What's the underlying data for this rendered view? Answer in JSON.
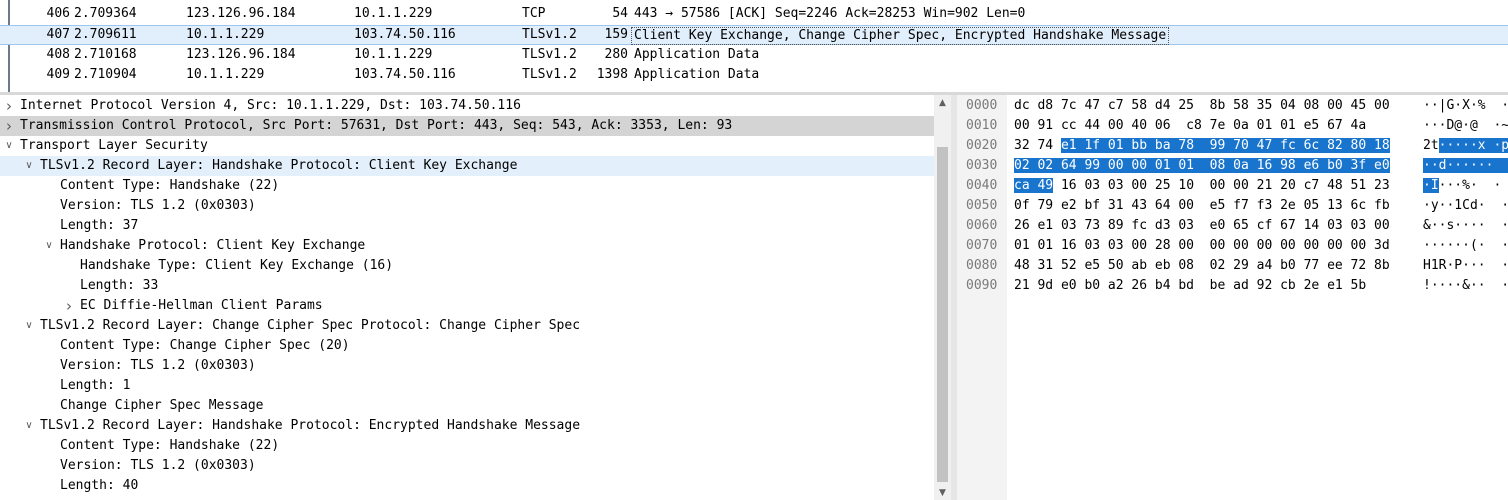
{
  "packet_list": {
    "rows": [
      {
        "no": "406",
        "time": "2.709364",
        "src": "123.126.96.184",
        "dst": "10.1.1.229",
        "proto": "TCP",
        "len": "54",
        "info": "443 → 57586 [ACK] Seq=2246 Ack=28253 Win=902 Len=0"
      },
      {
        "no": "407",
        "time": "2.709611",
        "src": "10.1.1.229",
        "dst": "103.74.50.116",
        "proto": "TLSv1.2",
        "len": "159",
        "info": "Client Key Exchange, Change Cipher Spec, Encrypted Handshake Message"
      },
      {
        "no": "408",
        "time": "2.710168",
        "src": "123.126.96.184",
        "dst": "10.1.1.229",
        "proto": "TLSv1.2",
        "len": "280",
        "info": "Application Data"
      },
      {
        "no": "409",
        "time": "2.710904",
        "src": "10.1.1.229",
        "dst": "103.74.50.116",
        "proto": "TLSv1.2",
        "len": "1398",
        "info": "Application Data"
      }
    ]
  },
  "details": {
    "rows": [
      {
        "indent": 0,
        "chevron": "right",
        "text": "Internet Protocol Version 4, Src: 10.1.1.229, Dst: 103.74.50.116"
      },
      {
        "indent": 0,
        "chevron": "right",
        "text": "Transmission Control Protocol, Src Port: 57631, Dst Port: 443, Seq: 543, Ack: 3353, Len: 93"
      },
      {
        "indent": 0,
        "chevron": "down",
        "text": "Transport Layer Security"
      },
      {
        "indent": 1,
        "chevron": "down",
        "text": "TLSv1.2 Record Layer: Handshake Protocol: Client Key Exchange"
      },
      {
        "indent": 2,
        "chevron": "",
        "text": "Content Type: Handshake (22)"
      },
      {
        "indent": 2,
        "chevron": "",
        "text": "Version: TLS 1.2 (0x0303)"
      },
      {
        "indent": 2,
        "chevron": "",
        "text": "Length: 37"
      },
      {
        "indent": 2,
        "chevron": "down",
        "text": "Handshake Protocol: Client Key Exchange"
      },
      {
        "indent": 3,
        "chevron": "",
        "text": "Handshake Type: Client Key Exchange (16)"
      },
      {
        "indent": 3,
        "chevron": "",
        "text": "Length: 33"
      },
      {
        "indent": 3,
        "chevron": "right",
        "text": "EC Diffie-Hellman Client Params"
      },
      {
        "indent": 1,
        "chevron": "down",
        "text": "TLSv1.2 Record Layer: Change Cipher Spec Protocol: Change Cipher Spec"
      },
      {
        "indent": 2,
        "chevron": "",
        "text": "Content Type: Change Cipher Spec (20)"
      },
      {
        "indent": 2,
        "chevron": "",
        "text": "Version: TLS 1.2 (0x0303)"
      },
      {
        "indent": 2,
        "chevron": "",
        "text": "Length: 1"
      },
      {
        "indent": 2,
        "chevron": "",
        "text": "Change Cipher Spec Message"
      },
      {
        "indent": 1,
        "chevron": "down",
        "text": "TLSv1.2 Record Layer: Handshake Protocol: Encrypted Handshake Message"
      },
      {
        "indent": 2,
        "chevron": "",
        "text": "Content Type: Handshake (22)"
      },
      {
        "indent": 2,
        "chevron": "",
        "text": "Version: TLS 1.2 (0x0303)"
      },
      {
        "indent": 2,
        "chevron": "",
        "text": "Length: 40"
      }
    ]
  },
  "bytes": {
    "rows": [
      {
        "offset": "0000",
        "hex": [
          "dc d8 7c 47 c7 58 d4 25  8b 58 35 04 08 00 45 00"
        ],
        "hexsel": "",
        "hexafter": "",
        "ascii": "··|G·X·%  ·X",
        "asciisel": "",
        "asciiafter": ""
      },
      {
        "offset": "0010",
        "hex": [
          "00 91 cc 44 00 40 06  c8 7e 0a 01 01 e5 67 4a"
        ],
        "hexsel": "",
        "hexafter": "",
        "ascii": "···D@·@  ·~",
        "asciisel": "",
        "asciiafter": ""
      },
      {
        "offset": "0020",
        "hex": [
          "32 74 "
        ],
        "hexsel": "e1 1f 01 bb ba 78  99 70 47 fc 6c 82 80 18",
        "hexafter": "",
        "ascii": "2t",
        "asciisel": "·····x ·p",
        "asciiafter": ""
      },
      {
        "offset": "0030",
        "hex": [
          ""
        ],
        "hexsel": "02 02 64 99 00 00 01 01  08 0a 16 98 e6 b0 3f e0",
        "hexafter": "",
        "ascii": "",
        "asciisel": "··d······  ·",
        "asciiafter": ""
      },
      {
        "offset": "0040",
        "hex": [
          ""
        ],
        "hexsel": "ca 49",
        "hexafter": " 16 03 03 00 25 10  00 00 21 20 c7 48 51 23",
        "ascii": "",
        "asciisel": "·I",
        "asciiafter": "···%·  ·"
      },
      {
        "offset": "0050",
        "hex": [
          "0f 79 e2 bf 31 43 64 00  e5 f7 f3 2e 05 13 6c fb"
        ],
        "hexsel": "",
        "hexafter": "",
        "ascii": "·y··1Cd·  ·",
        "asciisel": "",
        "asciiafter": ""
      },
      {
        "offset": "0060",
        "hex": [
          "26 e1 03 73 89 fc d3 03  e0 65 cf 67 14 03 03 00"
        ],
        "hexsel": "",
        "hexafter": "",
        "ascii": "&··s····  ·e",
        "asciisel": "",
        "asciiafter": ""
      },
      {
        "offset": "0070",
        "hex": [
          "01 01 16 03 03 00 28 00  00 00 00 00 00 00 00 3d"
        ],
        "hexsel": "",
        "hexafter": "",
        "ascii": "······(·  ·",
        "asciisel": "",
        "asciiafter": ""
      },
      {
        "offset": "0080",
        "hex": [
          "48 31 52 e5 50 ab eb 08  02 29 a4 b0 77 ee 72 8b"
        ],
        "hexsel": "",
        "hexafter": "",
        "ascii": "H1R·P···  ·)",
        "asciisel": "",
        "asciiafter": ""
      },
      {
        "offset": "0090",
        "hex": [
          "21 9d e0 b0 a2 26 b4 bd  be ad 92 cb 2e e1 5b"
        ],
        "hexsel": "",
        "hexafter": "",
        "ascii": "!····&··  ·",
        "asciisel": "",
        "asciiafter": ""
      }
    ]
  },
  "colors": {
    "selected_packet_bg": "#e1eefb",
    "selected_field_bg": "#e3effa",
    "gray_field_bg": "#d4d4d4",
    "byte_selection": "#1874cd"
  }
}
